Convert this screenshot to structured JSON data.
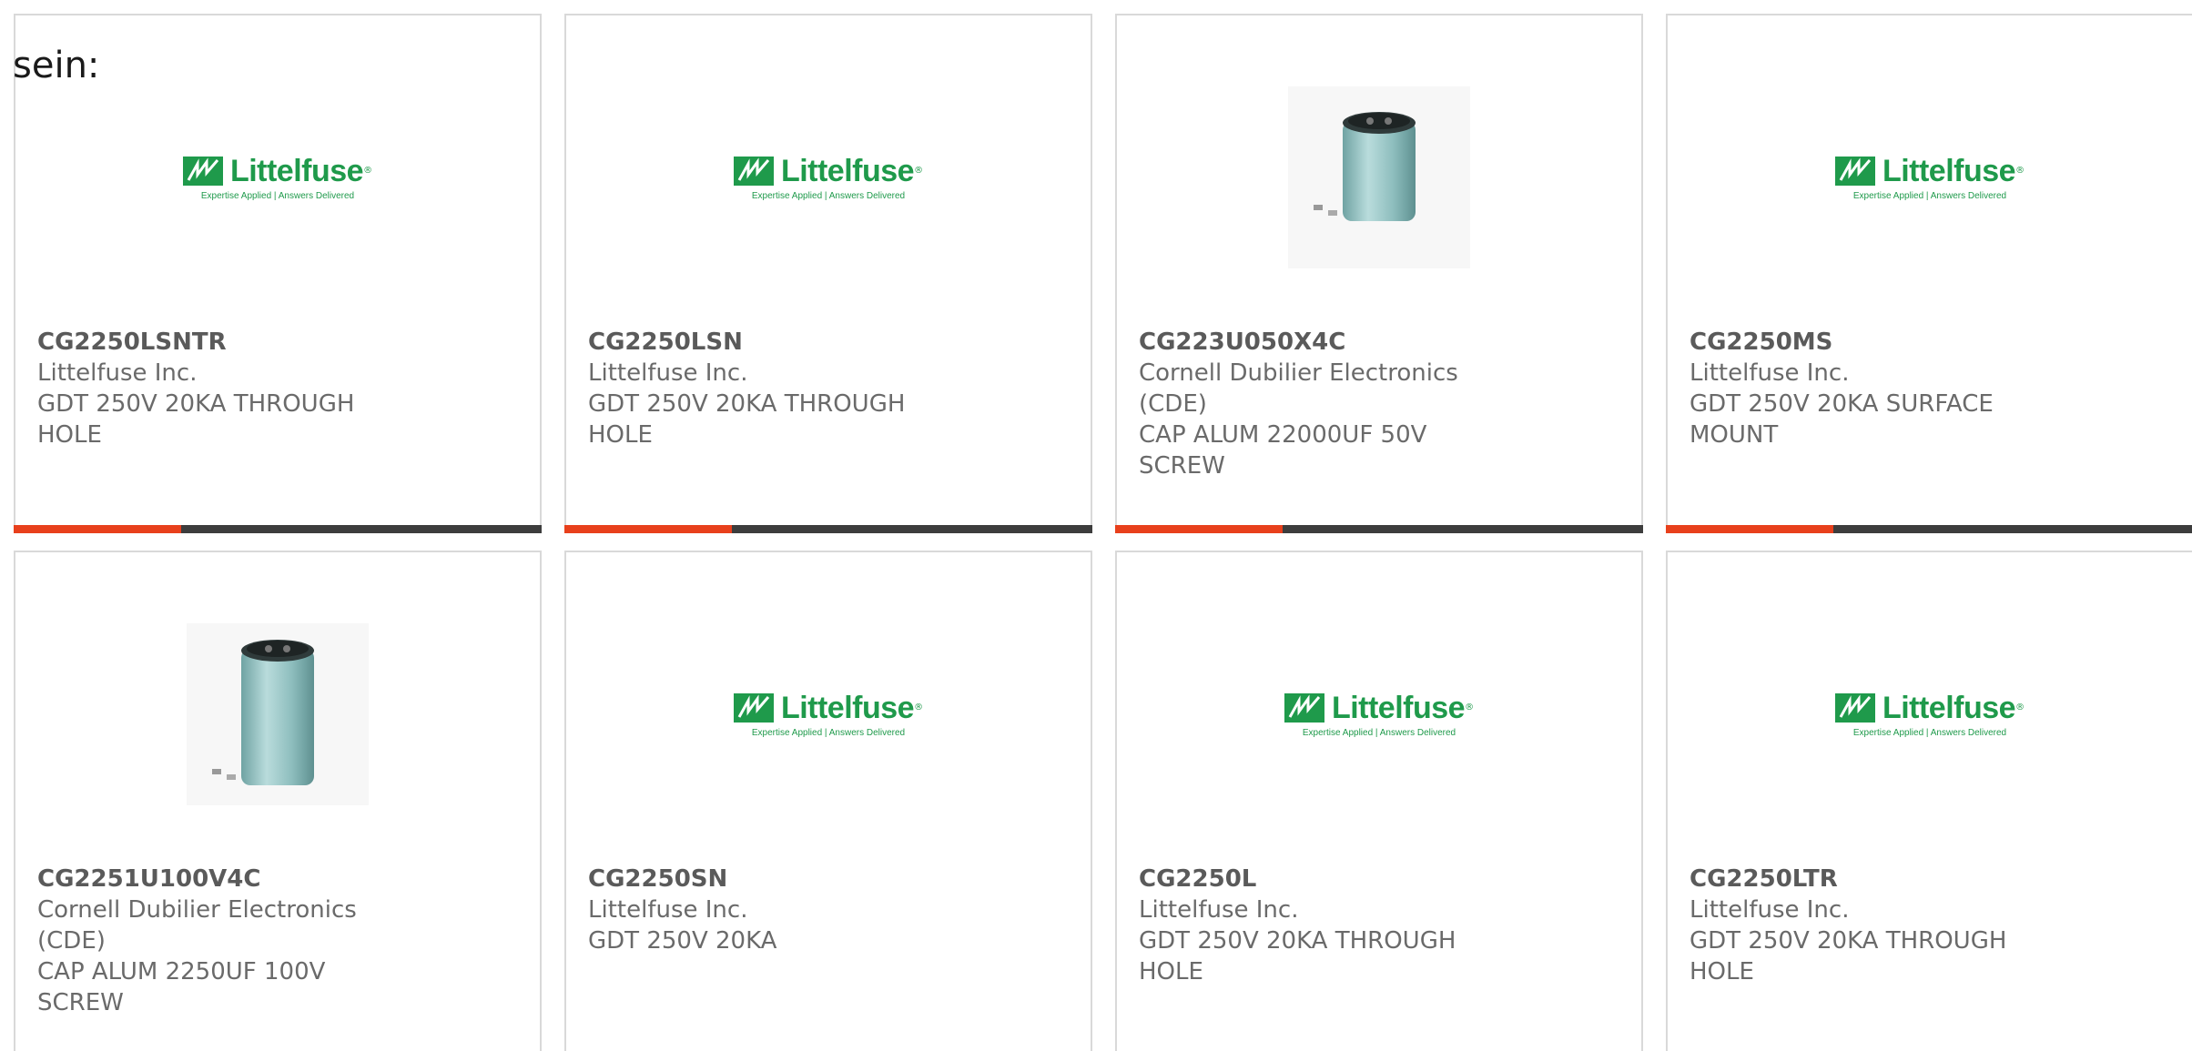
{
  "intro_text": "sein:",
  "colors": {
    "accent": "#e8401c",
    "bar_dark": "#3d3d3d",
    "brand_green": "#1f9a4b",
    "capacitor_body": "#8fbdbd"
  },
  "logo": {
    "name": "Littelfuse",
    "tagline": "Expertise Applied | Answers Delivered"
  },
  "products": [
    {
      "part_number": "CG2250LSNTR",
      "manufacturer": "Littelfuse Inc.",
      "description": "GDT 250V 20KA THROUGH HOLE",
      "image": "littelfuse-logo",
      "bar": true
    },
    {
      "part_number": "CG2250LSN",
      "manufacturer": "Littelfuse Inc.",
      "description": "GDT 250V 20KA THROUGH HOLE",
      "image": "littelfuse-logo",
      "bar": true
    },
    {
      "part_number": "CG223U050X4C",
      "manufacturer": "Cornell Dubilier Electronics (CDE)",
      "description": "CAP ALUM 22000UF 50V SCREW",
      "image": "capacitor-short",
      "bar": true
    },
    {
      "part_number": "CG2250MS",
      "manufacturer": "Littelfuse Inc.",
      "description": "GDT 250V 20KA SURFACE MOUNT",
      "image": "littelfuse-logo",
      "bar": true
    },
    {
      "part_number": "CG2251U100V4C",
      "manufacturer": "Cornell Dubilier Electronics (CDE)",
      "description": "CAP ALUM 2250UF 100V SCREW",
      "image": "capacitor-tall",
      "bar": false
    },
    {
      "part_number": "CG2250SN",
      "manufacturer": "Littelfuse Inc.",
      "description": "GDT 250V 20KA",
      "image": "littelfuse-logo",
      "bar": false
    },
    {
      "part_number": "CG2250L",
      "manufacturer": "Littelfuse Inc.",
      "description": "GDT 250V 20KA THROUGH HOLE",
      "image": "littelfuse-logo",
      "bar": false
    },
    {
      "part_number": "CG2250LTR",
      "manufacturer": "Littelfuse Inc.",
      "description": "GDT 250V 20KA THROUGH HOLE",
      "image": "littelfuse-logo",
      "bar": false
    }
  ]
}
